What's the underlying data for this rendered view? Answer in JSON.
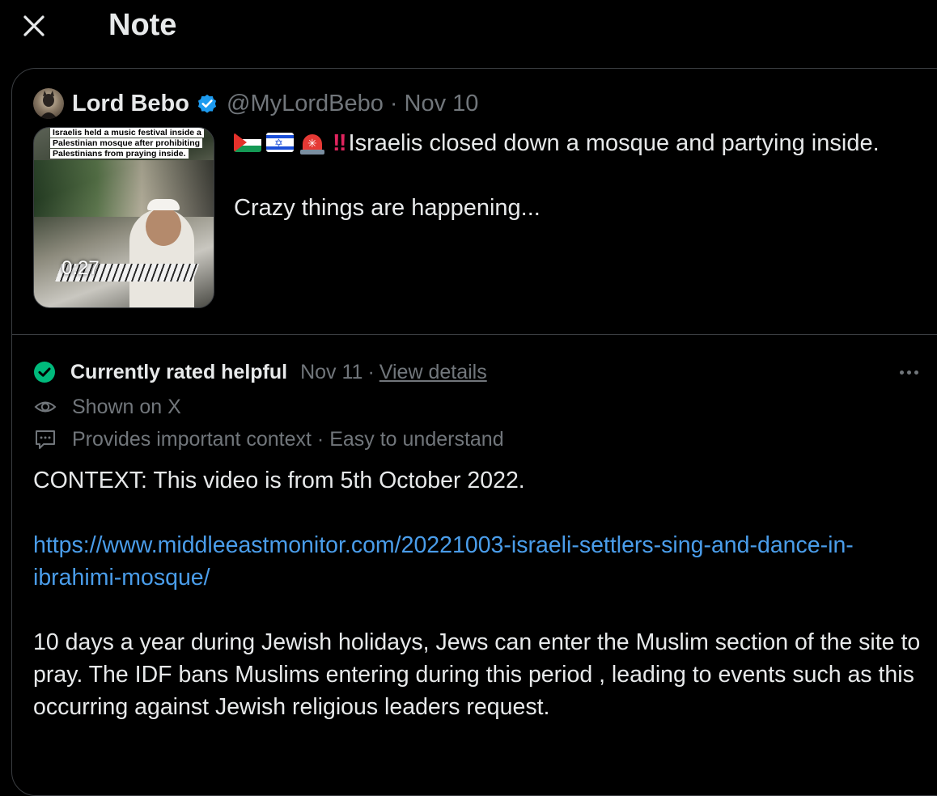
{
  "header": {
    "close_icon": "close-icon",
    "title": "Note"
  },
  "tweet": {
    "author_name": "Lord Bebo",
    "verified_icon": "verified-badge-icon",
    "handle": "@MyLordBebo",
    "separator": "·",
    "date": "Nov 10",
    "media": {
      "overlay_caption": "Israelis held a music festival inside a Palestinian mosque after prohibiting Palestinians from praying inside.",
      "duration": "0:27"
    },
    "text_line1": "Israelis closed down a mosque and partying inside.",
    "text_line2": "Crazy things are happening...",
    "emoji": [
      "palestine-flag",
      "israel-flag",
      "police-siren",
      "double-exclamation"
    ],
    "emoji_bangs": "‼"
  },
  "note": {
    "status_icon": "check-circle-icon",
    "status_label": "Currently rated helpful",
    "status_date": "Nov 11",
    "separator": "·",
    "view_details": "View details",
    "more_icon": "more-horizontal-icon",
    "shown_label": "Shown on X",
    "context_label": "Provides important context · Easy to understand",
    "body_para1": "CONTEXT: This video is from 5th October 2022.",
    "body_link": "https://www.middleeastmonitor.com/20221003-israeli-settlers-sing-and-dance-in-ibrahimi-mosque/",
    "body_para3": "10 days a year during Jewish holidays, Jews can enter the Muslim section of the site to pray. The IDF bans Muslims entering during this period , leading to events such as this occurring against Jewish religious leaders request."
  },
  "colors": {
    "background": "#000000",
    "text_primary": "#e7e9ea",
    "text_secondary": "#71767b",
    "link": "#4a9dea",
    "verified": "#1d9bf0",
    "helpful": "#00ba7c",
    "border": "#3a3d41"
  }
}
